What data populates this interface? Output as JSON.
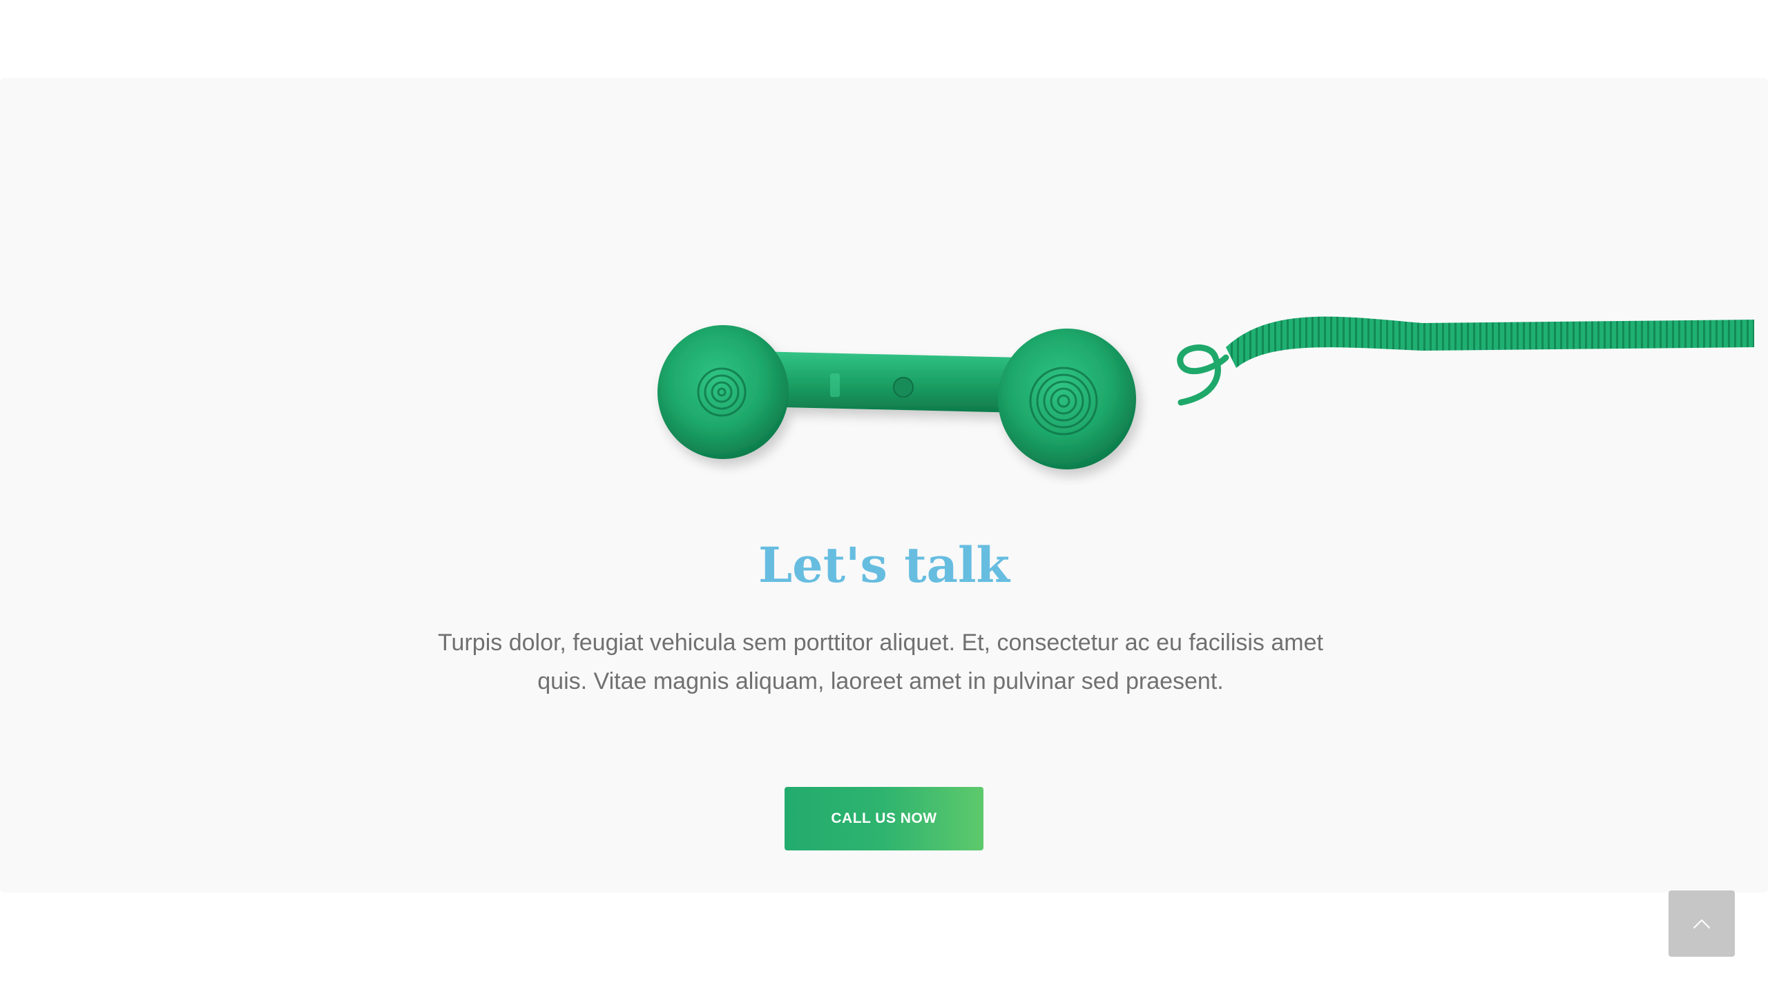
{
  "cta": {
    "headline": "Let's talk",
    "lead": "Turpis dolor, feugiat vehicula sem porttitor aliquet. Et, consectetur ac eu facilisis amet quis. Vitae magnis aliquam, laoreet amet in pulvinar sed praesent.",
    "button_label": "CALL US NOW",
    "illustration_icon": "green-telephone-handset-image"
  },
  "back_to_top": {
    "icon": "chevron-up-icon"
  },
  "colors": {
    "section_background": "#f9f9f9",
    "headline": "#66bde0",
    "body_text": "#707070",
    "button_gradient_start": "#23ab6e",
    "button_gradient_end": "#5ec96c",
    "phone_green": "#1ea86a",
    "back_to_top_background": "#c6c6c6"
  }
}
